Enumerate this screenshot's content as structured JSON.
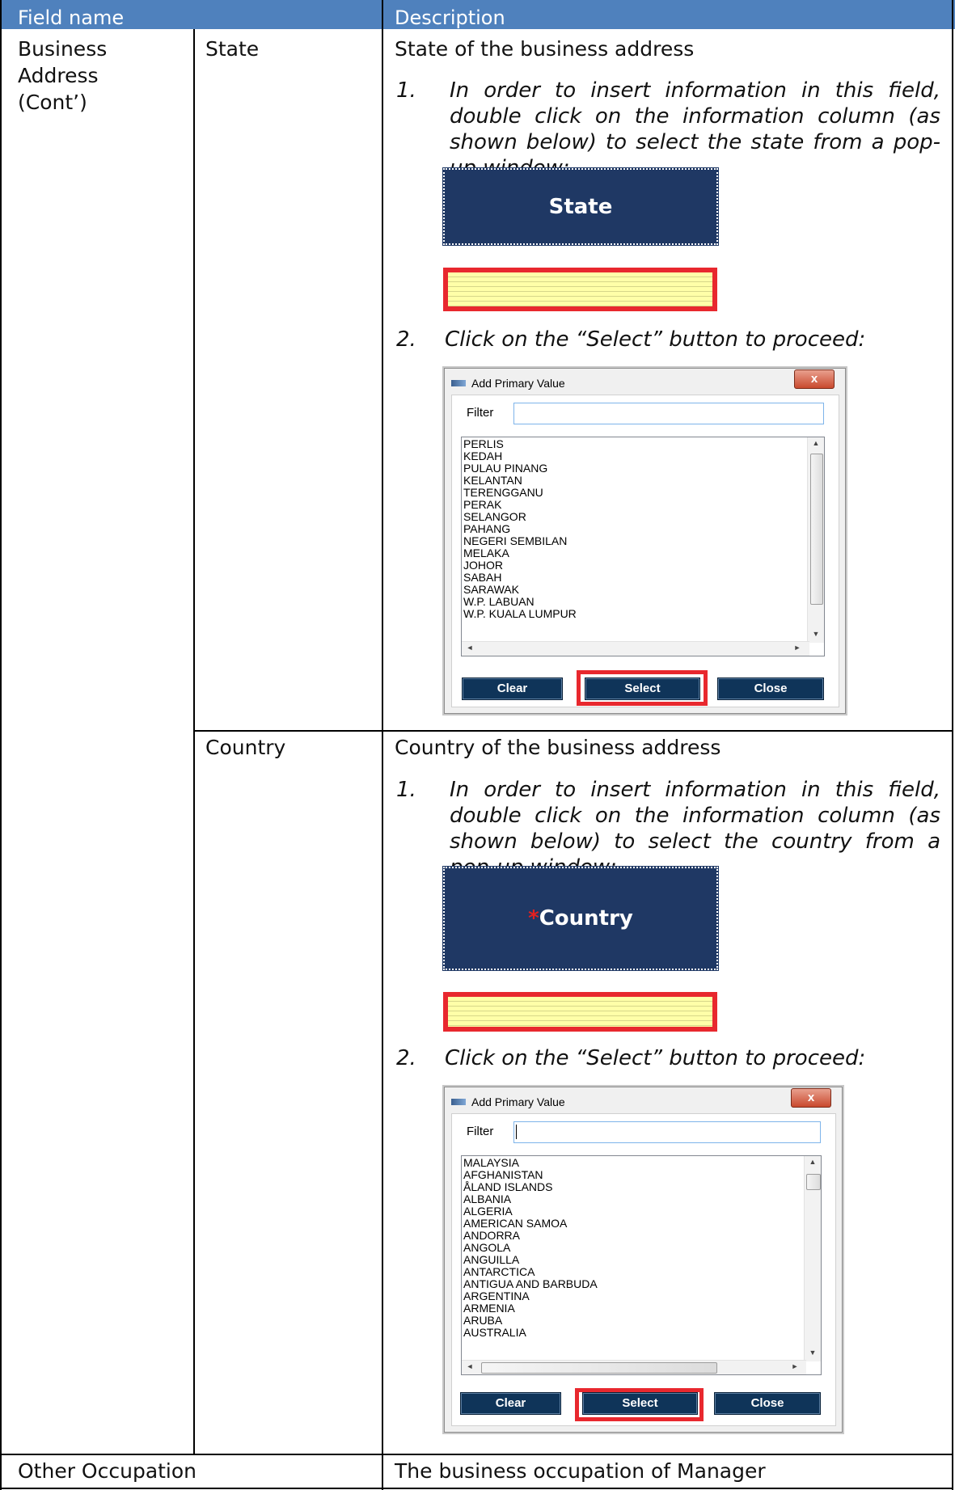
{
  "table": {
    "header": {
      "field_name": "Field name",
      "description": "Description"
    },
    "rows": {
      "business_address": {
        "field_name": "Business Address (Cont’)",
        "state": {
          "subfield": "State",
          "description": "State of the business address",
          "step1_num": "1.",
          "step1": "In order to insert information in this field, double click on the information column (as shown below) to select the state from a pop-up window:",
          "header_box_label": "State",
          "step2_num": "2.",
          "step2": "Click on the “Select” button to proceed:",
          "dialog": {
            "title": "Add Primary Value",
            "close_glyph": "x",
            "filter_label": "Filter",
            "filter_value": "",
            "items": [
              "PERLIS",
              "KEDAH",
              "PULAU PINANG",
              "KELANTAN",
              "TERENGGANU",
              "PERAK",
              "SELANGOR",
              "PAHANG",
              "NEGERI SEMBILAN",
              "MELAKA",
              "JOHOR",
              "SABAH",
              "SARAWAK",
              "W.P. LABUAN",
              "W.P. KUALA LUMPUR"
            ],
            "clear_label": "Clear",
            "select_label": "Select",
            "close_label": "Close"
          }
        },
        "country": {
          "subfield": "Country",
          "description": "Country of the business address",
          "step1_num": "1.",
          "step1": "In order to insert information in this field, double click on the information column (as shown below) to select the country from a pop-up window:",
          "header_box_star": "*",
          "header_box_label": "Country",
          "step2_num": "2.",
          "step2": "Click on the “Select” button to proceed:",
          "dialog": {
            "title": "Add Primary Value",
            "close_glyph": "x",
            "filter_label": "Filter",
            "filter_value": "",
            "items": [
              "MALAYSIA",
              "AFGHANISTAN",
              "ÅLAND ISLANDS",
              "ALBANIA",
              "ALGERIA",
              "AMERICAN SAMOA",
              "ANDORRA",
              "ANGOLA",
              "ANGUILLA",
              "ANTARCTICA",
              "ANTIGUA AND BARBUDA",
              "ARGENTINA",
              "ARMENIA",
              "ARUBA",
              "AUSTRALIA"
            ],
            "clear_label": "Clear",
            "select_label": "Select",
            "close_label": "Close"
          }
        }
      },
      "other_occupation": {
        "field_name": "Other Occupation",
        "description": "The business occupation of Manager"
      }
    }
  },
  "colors": {
    "header_bg": "#4f81bd",
    "header_box_bg": "#1f3864",
    "highlight_red": "#e8282e",
    "info_column_yellow": "#ffffa8",
    "button_navy": "#0f3459"
  },
  "icons": {
    "scroll_up": "up-arrow-icon",
    "scroll_down": "down-arrow-icon",
    "close": "close-icon",
    "app": "app-icon"
  }
}
